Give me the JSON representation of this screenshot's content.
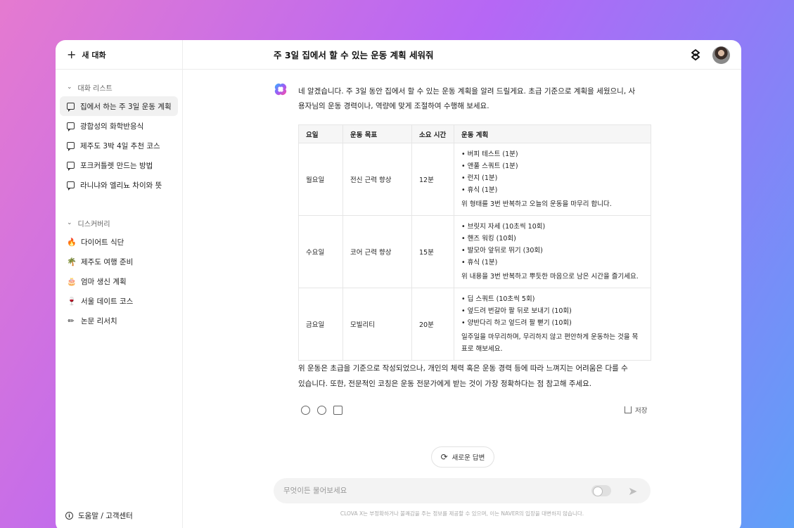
{
  "sidebar": {
    "new_chat": "새 대화",
    "conversations_header": "대화 리스트",
    "conversations": [
      "집에서 하는 주 3일 운동 계획",
      "광합성의 화학반응식",
      "제주도 3박 4일 추천 코스",
      "포크커틀렛 만드는 방법",
      "라니냐와 엘리뇨 차이와 뜻"
    ],
    "discovery_header": "디스커버리",
    "discovery": [
      {
        "icon": "🔥",
        "label": "다이어트 식단"
      },
      {
        "icon": "🌴",
        "label": "제주도 여행 준비"
      },
      {
        "icon": "🎂",
        "label": "엄마 생신 계획"
      },
      {
        "icon": "🍷",
        "label": "서울 데이트 코스"
      },
      {
        "icon": "✏",
        "label": "논문 리서치"
      }
    ],
    "help": "도움말 / 고객센터"
  },
  "header": {
    "title": "주 3일  집에서 할 수 있는 운동 계획 세워줘"
  },
  "answer": {
    "intro": "네 알겠습니다. 주 3일 동안 집에서 할 수 있는 운동 계획을 알려 드릴게요. 초급 기준으로 계획을 세웠으니, 사용자님의 운동 경력이나, 역량에 맞게 조절하여 수행해 보세요.",
    "table": {
      "headers": [
        "요일",
        "운동 목표",
        "소요 시간",
        "운동 계획"
      ],
      "rows": [
        {
          "day": "월요일",
          "goal": "전신 근력 향상",
          "time": "12분",
          "items": [
            "버피 테스트 (1분)",
            "앤풀 스쿼트 (1분)",
            "런지 (1분)",
            "휴식 (1분)"
          ],
          "note": "위 형태를 3번 반복하고 오늘의 운동을 마무리 합니다."
        },
        {
          "day": "수요일",
          "goal": "코어 근력 향상",
          "time": "15분",
          "items": [
            "브릿지 자세 (10초씩 10회)",
            "핸즈 워킹 (10회)",
            "발모아 앞뒤로 뛰기 (30회)",
            "휴식 (1분)"
          ],
          "note": "위 내용을 3번 반복하고 뿌듯한 마음으로 남은 시간을 즐기세요."
        },
        {
          "day": "금요일",
          "goal": "모빌리티",
          "time": "20분",
          "items": [
            "딥 스쿼트 (10초씩 5회)",
            "엎드려 번갈아 팔 뒤로 보내기 (10회)",
            "양반다리 하고 엎드려 팔 뻗기 (10회)"
          ],
          "note": "일주일을 마무리하며, 무리하지 않고 편안하게 운동하는 것을 목표로 해보세요."
        }
      ]
    },
    "outro": "위 운동은 초급을 기준으로 작성되었으나, 개인의 체력 혹은 운동 경력 등에 따라 느껴지는 어려움은 다를 수 있습니다. 또한, 전문적인 코칭은 운동 전문가에게 받는 것이 가장 정확하다는 점 참고해 주세요.",
    "save_label": "저장"
  },
  "regenerate_label": "새로운 답변",
  "input": {
    "placeholder": "무엇이든 물어보세요",
    "value": ""
  },
  "footer": "CLOVA X는 부정확하거나 불쾌감을 주는 정보를 제공할 수 있으며, 이는 NAVER의 입장을 대변하지 않습니다."
}
